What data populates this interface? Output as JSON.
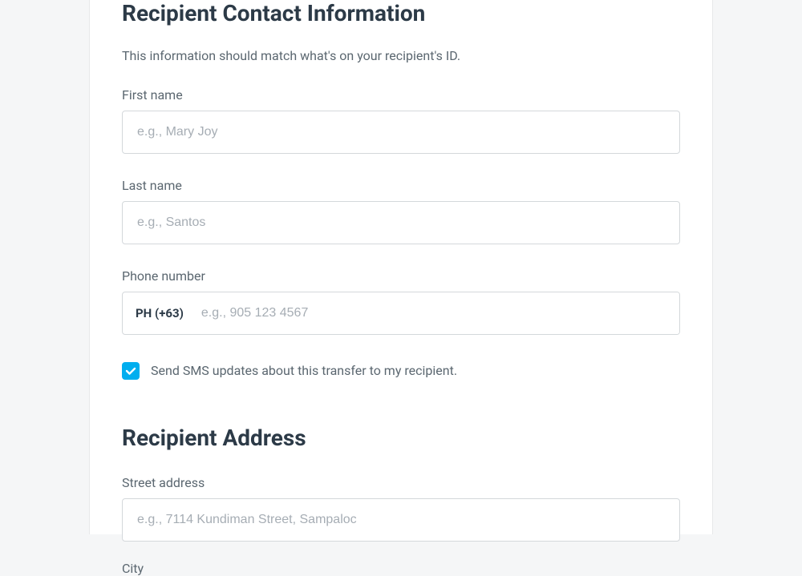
{
  "contact": {
    "title": "Recipient Contact Information",
    "subtitle": "This information should match what's on your recipient's ID.",
    "first_name_label": "First name",
    "first_name_placeholder": "e.g., Mary Joy",
    "last_name_label": "Last name",
    "last_name_placeholder": "e.g., Santos",
    "phone_label": "Phone number",
    "phone_prefix": "PH (+63)",
    "phone_placeholder": "e.g., 905 123 4567",
    "sms_checkbox_label": "Send SMS updates about this transfer to my recipient.",
    "sms_checked": true
  },
  "address": {
    "title": "Recipient Address",
    "street_label": "Street address",
    "street_placeholder": "e.g., 7114 Kundiman Street, Sampaloc",
    "city_label": "City"
  }
}
